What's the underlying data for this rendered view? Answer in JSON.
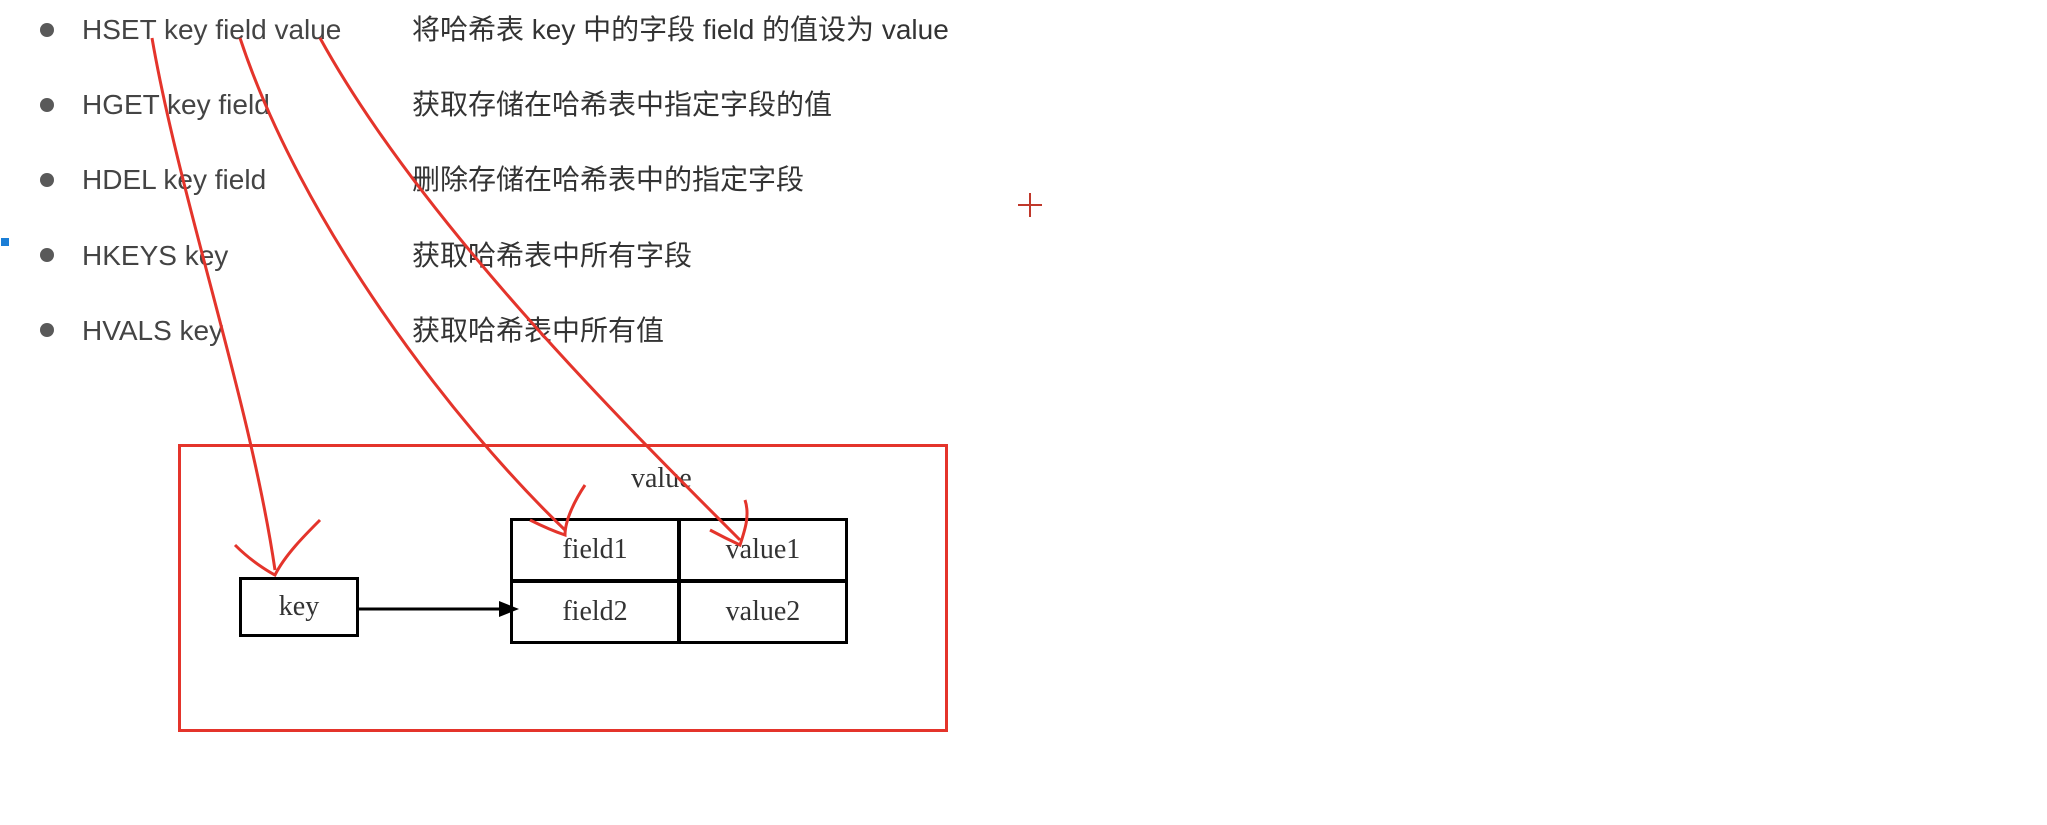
{
  "commands": [
    {
      "cmd": "HSET key field value",
      "desc": "将哈希表 key 中的字段 field 的值设为 value"
    },
    {
      "cmd": "HGET key field",
      "desc": "获取存储在哈希表中指定字段的值"
    },
    {
      "cmd": "HDEL key field",
      "desc": "删除存储在哈希表中的指定字段"
    },
    {
      "cmd": "HKEYS key",
      "desc": "获取哈希表中所有字段"
    },
    {
      "cmd": "HVALS key",
      "desc": "获取哈希表中所有值"
    }
  ],
  "diagram": {
    "header_label": "value",
    "key_label": "key",
    "rows": [
      {
        "field": "field1",
        "value": "value1"
      },
      {
        "field": "field2",
        "value": "value2"
      }
    ]
  }
}
